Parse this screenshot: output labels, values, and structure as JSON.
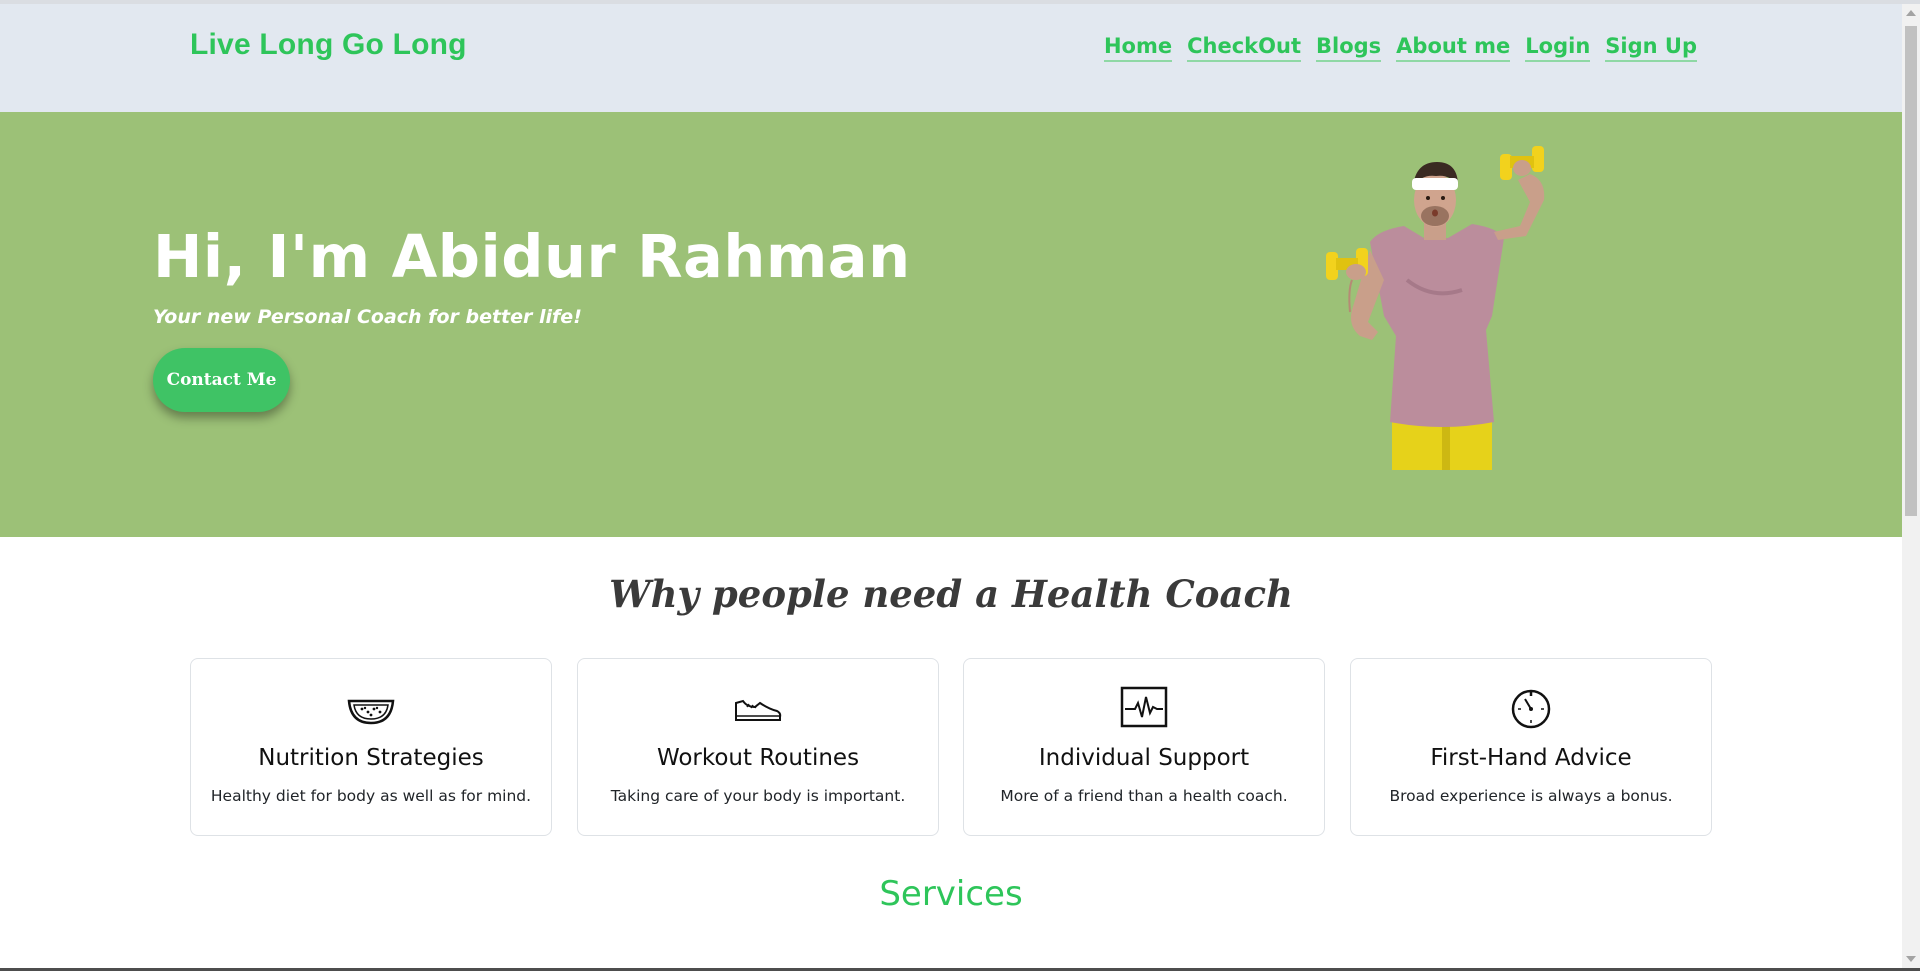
{
  "nav": {
    "brand": "Live Long Go Long",
    "links": [
      "Home",
      "CheckOut",
      "Blogs",
      "About me",
      "Login",
      "Sign Up"
    ]
  },
  "hero": {
    "title": "Hi, I'm Abidur Rahman",
    "subtitle": "Your new Personal Coach for better life!",
    "button": "Contact Me",
    "image_icon": "fitness-coach-photo"
  },
  "why": {
    "title": "Why people need a Health Coach",
    "cards": [
      {
        "icon": "watermelon-icon",
        "title": "Nutrition Strategies",
        "text": "Healthy diet for body as well as for mind."
      },
      {
        "icon": "sneaker-icon",
        "title": "Workout Routines",
        "text": "Taking care of your body is important."
      },
      {
        "icon": "heartbeat-monitor-icon",
        "title": "Individual Support",
        "text": "More of a friend than a health coach."
      },
      {
        "icon": "stopwatch-icon",
        "title": "First-Hand Advice",
        "text": "Broad experience is always a bonus."
      }
    ]
  },
  "services": {
    "title": "Services"
  },
  "colors": {
    "accent": "#2ec55a",
    "hero_bg": "#9cc177",
    "navbar_bg": "#e2e8f0",
    "button_bg": "#3fc365"
  }
}
